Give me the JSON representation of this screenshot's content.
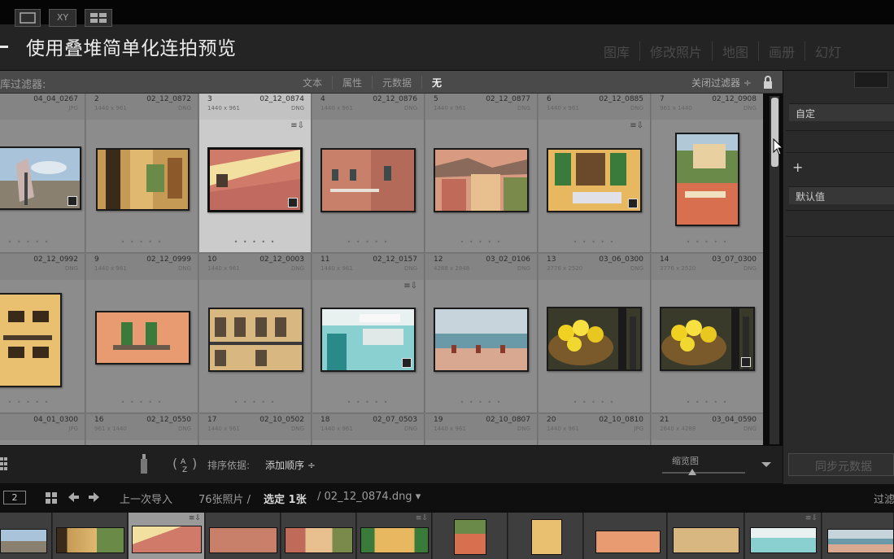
{
  "header": {
    "title": "使用叠堆简单化连拍预览",
    "modules": [
      "图库",
      "修改照片",
      "地图",
      "画册",
      "幻灯"
    ]
  },
  "filter_bar": {
    "label": "库过滤器:",
    "options": [
      "文本",
      "属性",
      "元数据",
      "无"
    ],
    "active_option": "无",
    "close_label": "关闭过滤器 ÷"
  },
  "grid": {
    "cells": [
      {
        "num": "",
        "fname": "04_04_0267",
        "dims": "",
        "ext": "JPG"
      },
      {
        "num": "2",
        "fname": "02_12_0872",
        "dims": "1440 x 961",
        "ext": "DNG"
      },
      {
        "num": "3",
        "fname": "02_12_0874",
        "dims": "1440 x 961",
        "ext": "DNG",
        "selected": true
      },
      {
        "num": "4",
        "fname": "02_12_0876",
        "dims": "1440 x 961",
        "ext": "DNG"
      },
      {
        "num": "5",
        "fname": "02_12_0877",
        "dims": "1440 x 961",
        "ext": "DNG"
      },
      {
        "num": "6",
        "fname": "02_12_0885",
        "dims": "1440 x 961",
        "ext": "DNG"
      },
      {
        "num": "7",
        "fname": "02_12_0908",
        "dims": "961 x 1440",
        "ext": "DNG"
      },
      {
        "num": "",
        "fname": "02_12_0992",
        "dims": "",
        "ext": "DNG"
      },
      {
        "num": "9",
        "fname": "02_12_0999",
        "dims": "1440 x 961",
        "ext": "DNG"
      },
      {
        "num": "10",
        "fname": "02_12_0003",
        "dims": "1440 x 961",
        "ext": "DNG"
      },
      {
        "num": "11",
        "fname": "02_12_0157",
        "dims": "1440 x 961",
        "ext": "DNG"
      },
      {
        "num": "12",
        "fname": "03_02_0106",
        "dims": "4288 x 2848",
        "ext": "DNG"
      },
      {
        "num": "13",
        "fname": "03_06_0300",
        "dims": "3776 x 2520",
        "ext": "DNG"
      },
      {
        "num": "14",
        "fname": "03_07_0300",
        "dims": "3776 x 2520",
        "ext": "DNG"
      },
      {
        "num": "",
        "fname": "04_01_0300",
        "dims": "",
        "ext": "JPG"
      },
      {
        "num": "16",
        "fname": "02_12_0550",
        "dims": "961 x 1440",
        "ext": "DNG"
      },
      {
        "num": "17",
        "fname": "02_10_0502",
        "dims": "1440 x 961",
        "ext": "DNG"
      },
      {
        "num": "18",
        "fname": "02_07_0503",
        "dims": "1440 x 961",
        "ext": "DNG"
      },
      {
        "num": "19",
        "fname": "02_10_0807",
        "dims": "1440 x 961",
        "ext": "DNG"
      },
      {
        "num": "20",
        "fname": "02_10_0810",
        "dims": "1440 x 961",
        "ext": "JPG"
      },
      {
        "num": "21",
        "fname": "03_04_0590",
        "dims": "2640 x 4288",
        "ext": "DNG"
      }
    ],
    "stars": "• • • • •"
  },
  "toolbar": {
    "xy_label": "XY",
    "sort_label": "排序依据:",
    "sort_value": "添加顺序 ÷",
    "thumb_label": "缩览图"
  },
  "right_panel": {
    "preset": "自定",
    "default_value": "默认值",
    "plus": "+",
    "sync_metadata": "同步元数据"
  },
  "filmstrip_bar": {
    "badge": "2",
    "source": "上一次导入",
    "count": "76张照片 / ",
    "selected": "选定 1张",
    "path": " / 02_12_0874.dng ▾",
    "filter": "过滤"
  },
  "colors": {
    "accent_selected": "#cbcbcb",
    "panel_dark": "#242424",
    "grid_bg": "#8c8c8c"
  }
}
